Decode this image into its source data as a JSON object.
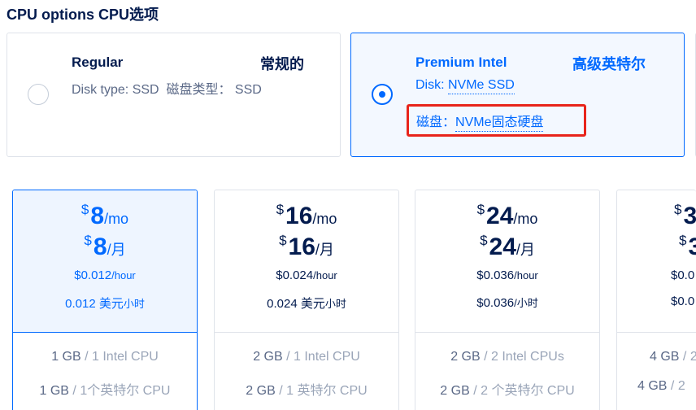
{
  "cpu_options": {
    "title": "CPU options  CPU选项",
    "options": [
      {
        "name": "Regular",
        "name_cn": "常规的",
        "desc_label": "Disk type: ",
        "desc_value": "SSD",
        "desc_cn": "磁盘类型：  SSD",
        "selected": false
      },
      {
        "name": "Premium Intel",
        "name_cn": "高级英特尔",
        "desc_label": "Disk: ",
        "desc_value": "NVMe SSD",
        "desc_cn_label": "磁盘：",
        "desc_cn_value": "NVMe固态硬盘",
        "selected": true
      }
    ]
  },
  "plans": [
    {
      "currency": "$",
      "amount": "8",
      "per_mo": "/mo",
      "amount_cn": "8",
      "per_month_cn": "/月",
      "hourly": "$0.012",
      "per_hour": "/hour",
      "hourly_cn": "0.012 美元",
      "per_hour_cn": "小时",
      "spec_mem": "1 GB",
      "spec_cpu": "1 Intel CPU",
      "spec_mem_cn": "1 GB",
      "spec_cpu_cn": "1个英特尔 CPU",
      "selected": true
    },
    {
      "currency": "$",
      "amount": "16",
      "per_mo": "/mo",
      "amount_cn": "16",
      "per_month_cn": "/月",
      "hourly": "$0.024",
      "per_hour": "/hour",
      "hourly_cn": "0.024 美元",
      "per_hour_cn": "小时",
      "spec_mem": "2 GB",
      "spec_cpu": "1 Intel CPU",
      "spec_mem_cn": "2 GB",
      "spec_cpu_cn": "1 英特尔 CPU",
      "selected": false
    },
    {
      "currency": "$",
      "amount": "24",
      "per_mo": "/mo",
      "amount_cn": "24",
      "per_month_cn": "/月",
      "hourly": "$0.036",
      "per_hour": "/hour",
      "hourly_cn": "$0.036",
      "per_hour_cn": "/小时",
      "spec_mem": "2 GB",
      "spec_cpu": "2 Intel CPUs",
      "spec_mem_cn": "2 GB",
      "spec_cpu_cn": "2 个英特尔 CPU",
      "selected": false
    },
    {
      "currency": "$",
      "amount": "3",
      "per_mo": "",
      "amount_cn": "3",
      "per_month_cn": "",
      "hourly": "$0.0",
      "per_hour": "",
      "hourly_cn": "$0.0",
      "per_hour_cn": "",
      "spec_mem": "4 GB",
      "spec_cpu": "2",
      "spec_mem_cn": "4 GB",
      "spec_cpu_cn": "2",
      "selected": false
    }
  ],
  "colors": {
    "accent": "#0069ff",
    "highlight_box": "#e8241b",
    "text": "#031b4e",
    "muted": "#5b6987"
  }
}
